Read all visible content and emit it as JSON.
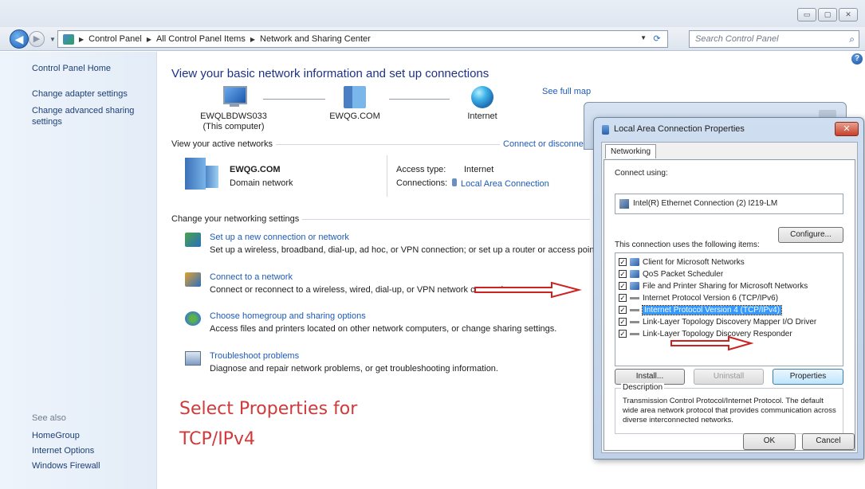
{
  "window": {
    "address_segments": [
      "Control Panel",
      "All Control Panel Items",
      "Network and Sharing Center"
    ],
    "search_placeholder": "Search Control Panel",
    "controls": {
      "minimize": "▭",
      "maximize": "▢",
      "close": "✕"
    }
  },
  "sidebar": {
    "home": "Control Panel Home",
    "links": [
      "Change adapter settings",
      "Change advanced sharing settings"
    ],
    "see_also_label": "See also",
    "see_also": [
      "HomeGroup",
      "Internet Options",
      "Windows Firewall"
    ]
  },
  "main": {
    "title": "View your basic network information and set up connections",
    "see_full_map": "See full map",
    "map_nodes": [
      {
        "name": "EWQLBDWS033",
        "sub": "(This computer)",
        "icon": "computer-icon"
      },
      {
        "name": "EWQG.COM",
        "sub": "",
        "icon": "domain-network-icon"
      },
      {
        "name": "Internet",
        "sub": "",
        "icon": "globe-icon"
      }
    ],
    "active_networks_label": "View your active networks",
    "connect_or_disconnect": "Connect or disconne",
    "active_network": {
      "name": "EWQG.COM",
      "type": "Domain network",
      "access_type_label": "Access type:",
      "access_type_value": "Internet",
      "connections_label": "Connections:",
      "connections_value": "Local Area Connection"
    },
    "change_settings_label": "Change your networking settings",
    "tasks": [
      {
        "link": "Set up a new connection or network",
        "desc": "Set up a wireless, broadband, dial-up, ad hoc, or VPN connection; or set up a router or access poin",
        "icon": "new-connection-icon"
      },
      {
        "link": "Connect to a network",
        "desc": "Connect or reconnect to a wireless, wired, dial-up, or VPN network connection.",
        "icon": "connect-network-icon"
      },
      {
        "link": "Choose homegroup and sharing options",
        "desc": "Access files and printers located on other network computers, or change sharing settings.",
        "icon": "homegroup-icon"
      },
      {
        "link": "Troubleshoot problems",
        "desc": "Diagnose and repair network problems, or get troubleshooting information.",
        "icon": "troubleshoot-icon"
      }
    ],
    "annotation": [
      "Select Properties for",
      "TCP/IPv4"
    ]
  },
  "dialog": {
    "title": "Local Area Connection Properties",
    "tab": "Networking",
    "connect_using_label": "Connect using:",
    "adapter": "Intel(R) Ethernet Connection (2) I219-LM",
    "configure_button": "Configure...",
    "items_label": "This connection uses the following items:",
    "items": [
      {
        "label": "Client for Microsoft Networks",
        "checked": true,
        "selected": false,
        "icon": "network-client-icon"
      },
      {
        "label": "QoS Packet Scheduler",
        "checked": true,
        "selected": false,
        "icon": "network-service-icon"
      },
      {
        "label": "File and Printer Sharing for Microsoft Networks",
        "checked": true,
        "selected": false,
        "icon": "network-service-icon"
      },
      {
        "label": "Internet Protocol Version 6 (TCP/IPv6)",
        "checked": true,
        "selected": false,
        "icon": "protocol-icon"
      },
      {
        "label": "Internet Protocol Version 4 (TCP/IPv4)",
        "checked": true,
        "selected": true,
        "icon": "protocol-icon"
      },
      {
        "label": "Link-Layer Topology Discovery Mapper I/O Driver",
        "checked": true,
        "selected": false,
        "icon": "protocol-icon"
      },
      {
        "label": "Link-Layer Topology Discovery Responder",
        "checked": true,
        "selected": false,
        "icon": "protocol-icon"
      }
    ],
    "install_button": "Install...",
    "uninstall_button": "Uninstall",
    "properties_button": "Properties",
    "description_label": "Description",
    "description_text": "Transmission Control Protocol/Internet Protocol. The default wide area network protocol that provides communication across diverse interconnected networks.",
    "ok_button": "OK",
    "cancel_button": "Cancel",
    "close_glyph": "✕"
  },
  "colors": {
    "annotation_red": "#cf3a3a",
    "link_blue": "#1e5bb5",
    "selection_blue": "#3399ff"
  }
}
